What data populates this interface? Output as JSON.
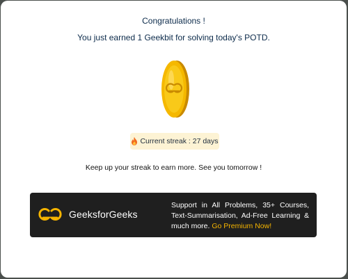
{
  "modal": {
    "title": "Congratulations !",
    "subtitle": "You just earned 1 Geekbit for solving today's POTD.",
    "coin_icon": "geekbit-coin-icon",
    "streak": {
      "icon": "fire-icon",
      "text": "Current streak : 27 days"
    },
    "keep_up": "Keep up your streak to earn more. See you tomorrow !",
    "banner": {
      "brand": "GeeksforGeeks",
      "logo_icon": "gfg-logo-icon",
      "text": "Support in All Problems, 35+ Courses, Text-Summarisation, Ad-Free Learning & much more.",
      "cta": "Go Premium Now!"
    }
  },
  "colors": {
    "title_text": "#0b2a4a",
    "coin_gold": "#f5b400",
    "streak_bg": "#fdf3d4",
    "banner_bg": "#1f1f1f",
    "cta": "#f5b400"
  }
}
